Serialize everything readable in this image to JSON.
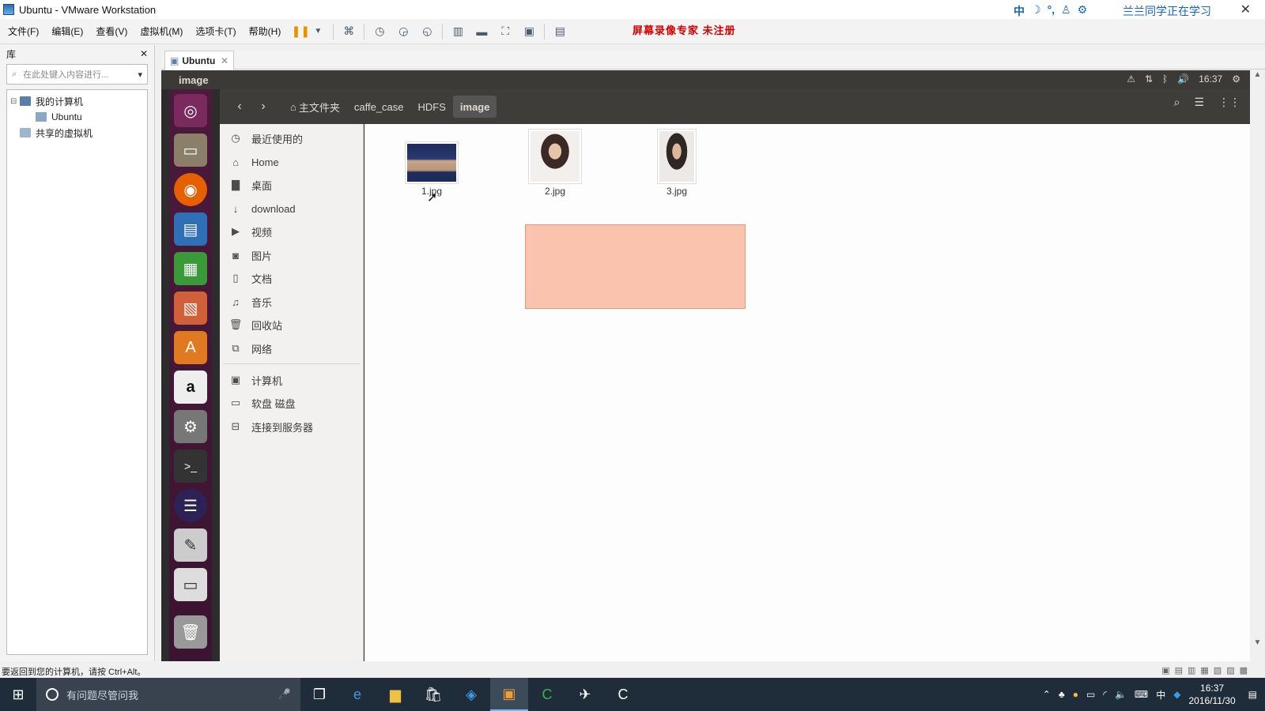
{
  "window": {
    "title": "Ubuntu - VMware Workstation"
  },
  "ime": {
    "mode": "中",
    "message": "兰兰同学正在学习"
  },
  "menu": [
    "文件(F)",
    "编辑(E)",
    "查看(V)",
    "虚拟机(M)",
    "选项卡(T)",
    "帮助(H)"
  ],
  "watermark": "屏幕录像专家  未注册",
  "library": {
    "title": "库",
    "search_placeholder": "在此处键入内容进行...",
    "tree": [
      "我的计算机",
      "Ubuntu",
      "共享的虚拟机"
    ]
  },
  "vm_tab": {
    "label": "Ubuntu"
  },
  "ubuntu": {
    "window_title": "image",
    "time": "16:37",
    "breadcrumb": [
      "主文件夹",
      "caffe_case",
      "HDFS",
      "image"
    ],
    "sidebar": [
      "最近使用的",
      "Home",
      "桌面",
      "download",
      "视频",
      "图片",
      "文档",
      "音乐",
      "回收站",
      "网络",
      "计算机",
      "软盘 磁盘",
      "连接到服务器"
    ],
    "files": [
      "1.jpg",
      "2.jpg",
      "3.jpg"
    ]
  },
  "status": "要返回到您的计算机，请按 Ctrl+Alt。",
  "taskbar": {
    "search_placeholder": "有问题尽管问我",
    "ime": "中",
    "time": "16:37",
    "date": "2016/11/30"
  }
}
